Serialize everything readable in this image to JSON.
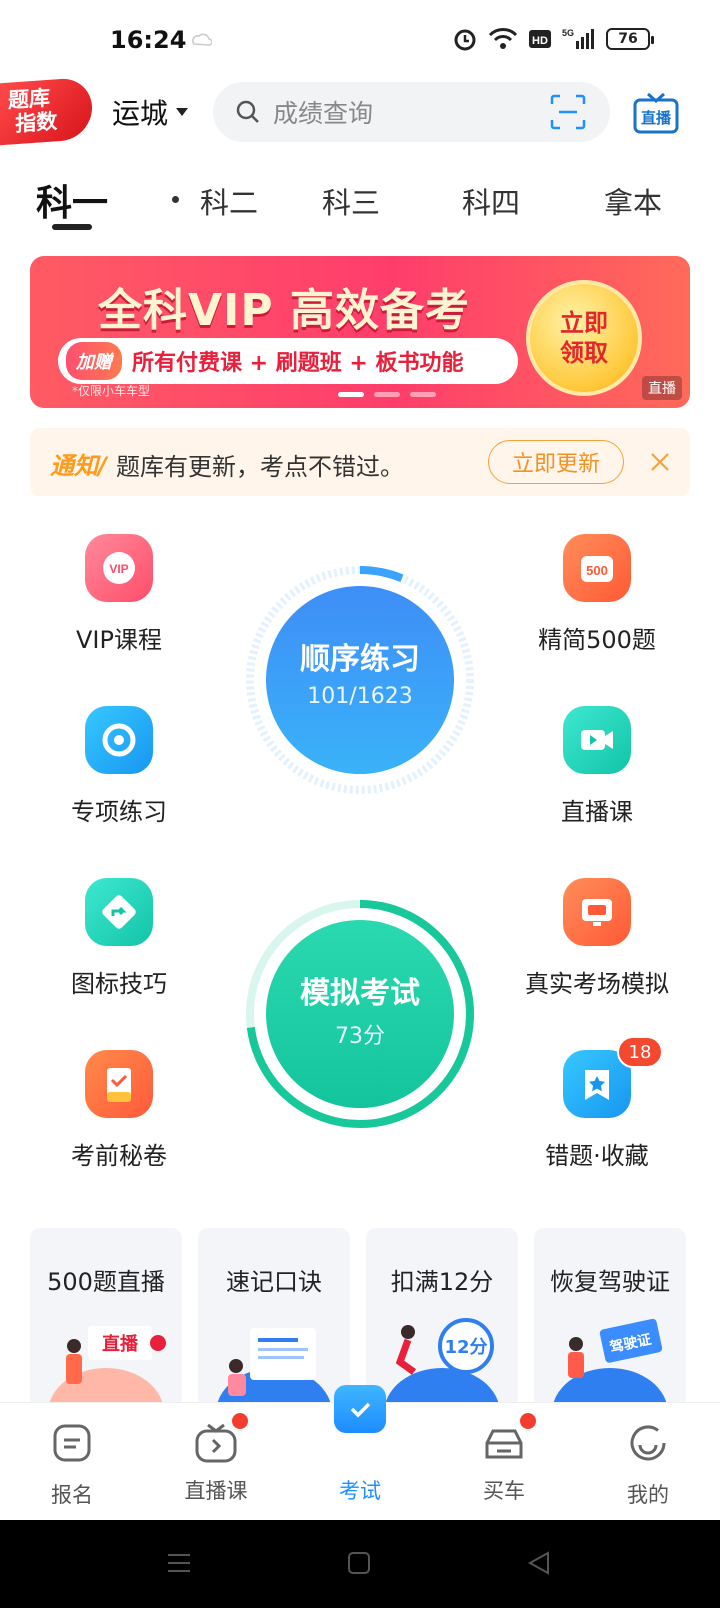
{
  "status_bar": {
    "time": "16:24",
    "battery": "76",
    "network": "5G"
  },
  "header": {
    "logo_text": "题库指数",
    "city": "运城",
    "search_placeholder": "成绩查询"
  },
  "tabs": [
    {
      "label": "科一",
      "active": true
    },
    {
      "label": "科二",
      "active": false
    },
    {
      "label": "科三",
      "active": false
    },
    {
      "label": "科四",
      "active": false
    },
    {
      "label": "拿本",
      "active": false
    }
  ],
  "banner": {
    "title": "全科VIP 高效备考",
    "gift_label": "加赠",
    "perks": "所有付费课 + 刷题班 + 板书功能",
    "note": "*仅限小车车型",
    "claim_line1": "立即",
    "claim_line2": "领取",
    "tag": "直播"
  },
  "notice": {
    "label": "通知/",
    "message": "题库有更新，考点不错过。",
    "button": "立即更新"
  },
  "features": {
    "vip": "VIP课程",
    "special": "专项练习",
    "signs": "图标技巧",
    "secret": "考前秘卷",
    "simple500": "精简500题",
    "live": "直播课",
    "real_exam": "真实考场模拟",
    "wrong_fav": "错题·收藏",
    "wrong_badge": "18"
  },
  "practice": {
    "label": "顺序练习",
    "progress": "101/1623",
    "done": 101,
    "total": 1623
  },
  "mock_exam": {
    "label": "模拟考试",
    "score": "73分",
    "score_value": 73
  },
  "cards": [
    {
      "title": "500题直播"
    },
    {
      "title": "速记口诀"
    },
    {
      "title": "扣满12分"
    },
    {
      "title": "恢复驾驶证"
    }
  ],
  "bottom_nav": [
    {
      "label": "报名",
      "active": false,
      "dot": false
    },
    {
      "label": "直播课",
      "active": false,
      "dot": true
    },
    {
      "label": "考试",
      "active": true,
      "dot": false
    },
    {
      "label": "买车",
      "active": false,
      "dot": true
    },
    {
      "label": "我的",
      "active": false,
      "dot": false
    }
  ],
  "colors": {
    "accent": "#1e90ff",
    "practice_blue": "#3a8cf5",
    "exam_green": "#1fcf9e",
    "notice_orange": "#f19224"
  }
}
